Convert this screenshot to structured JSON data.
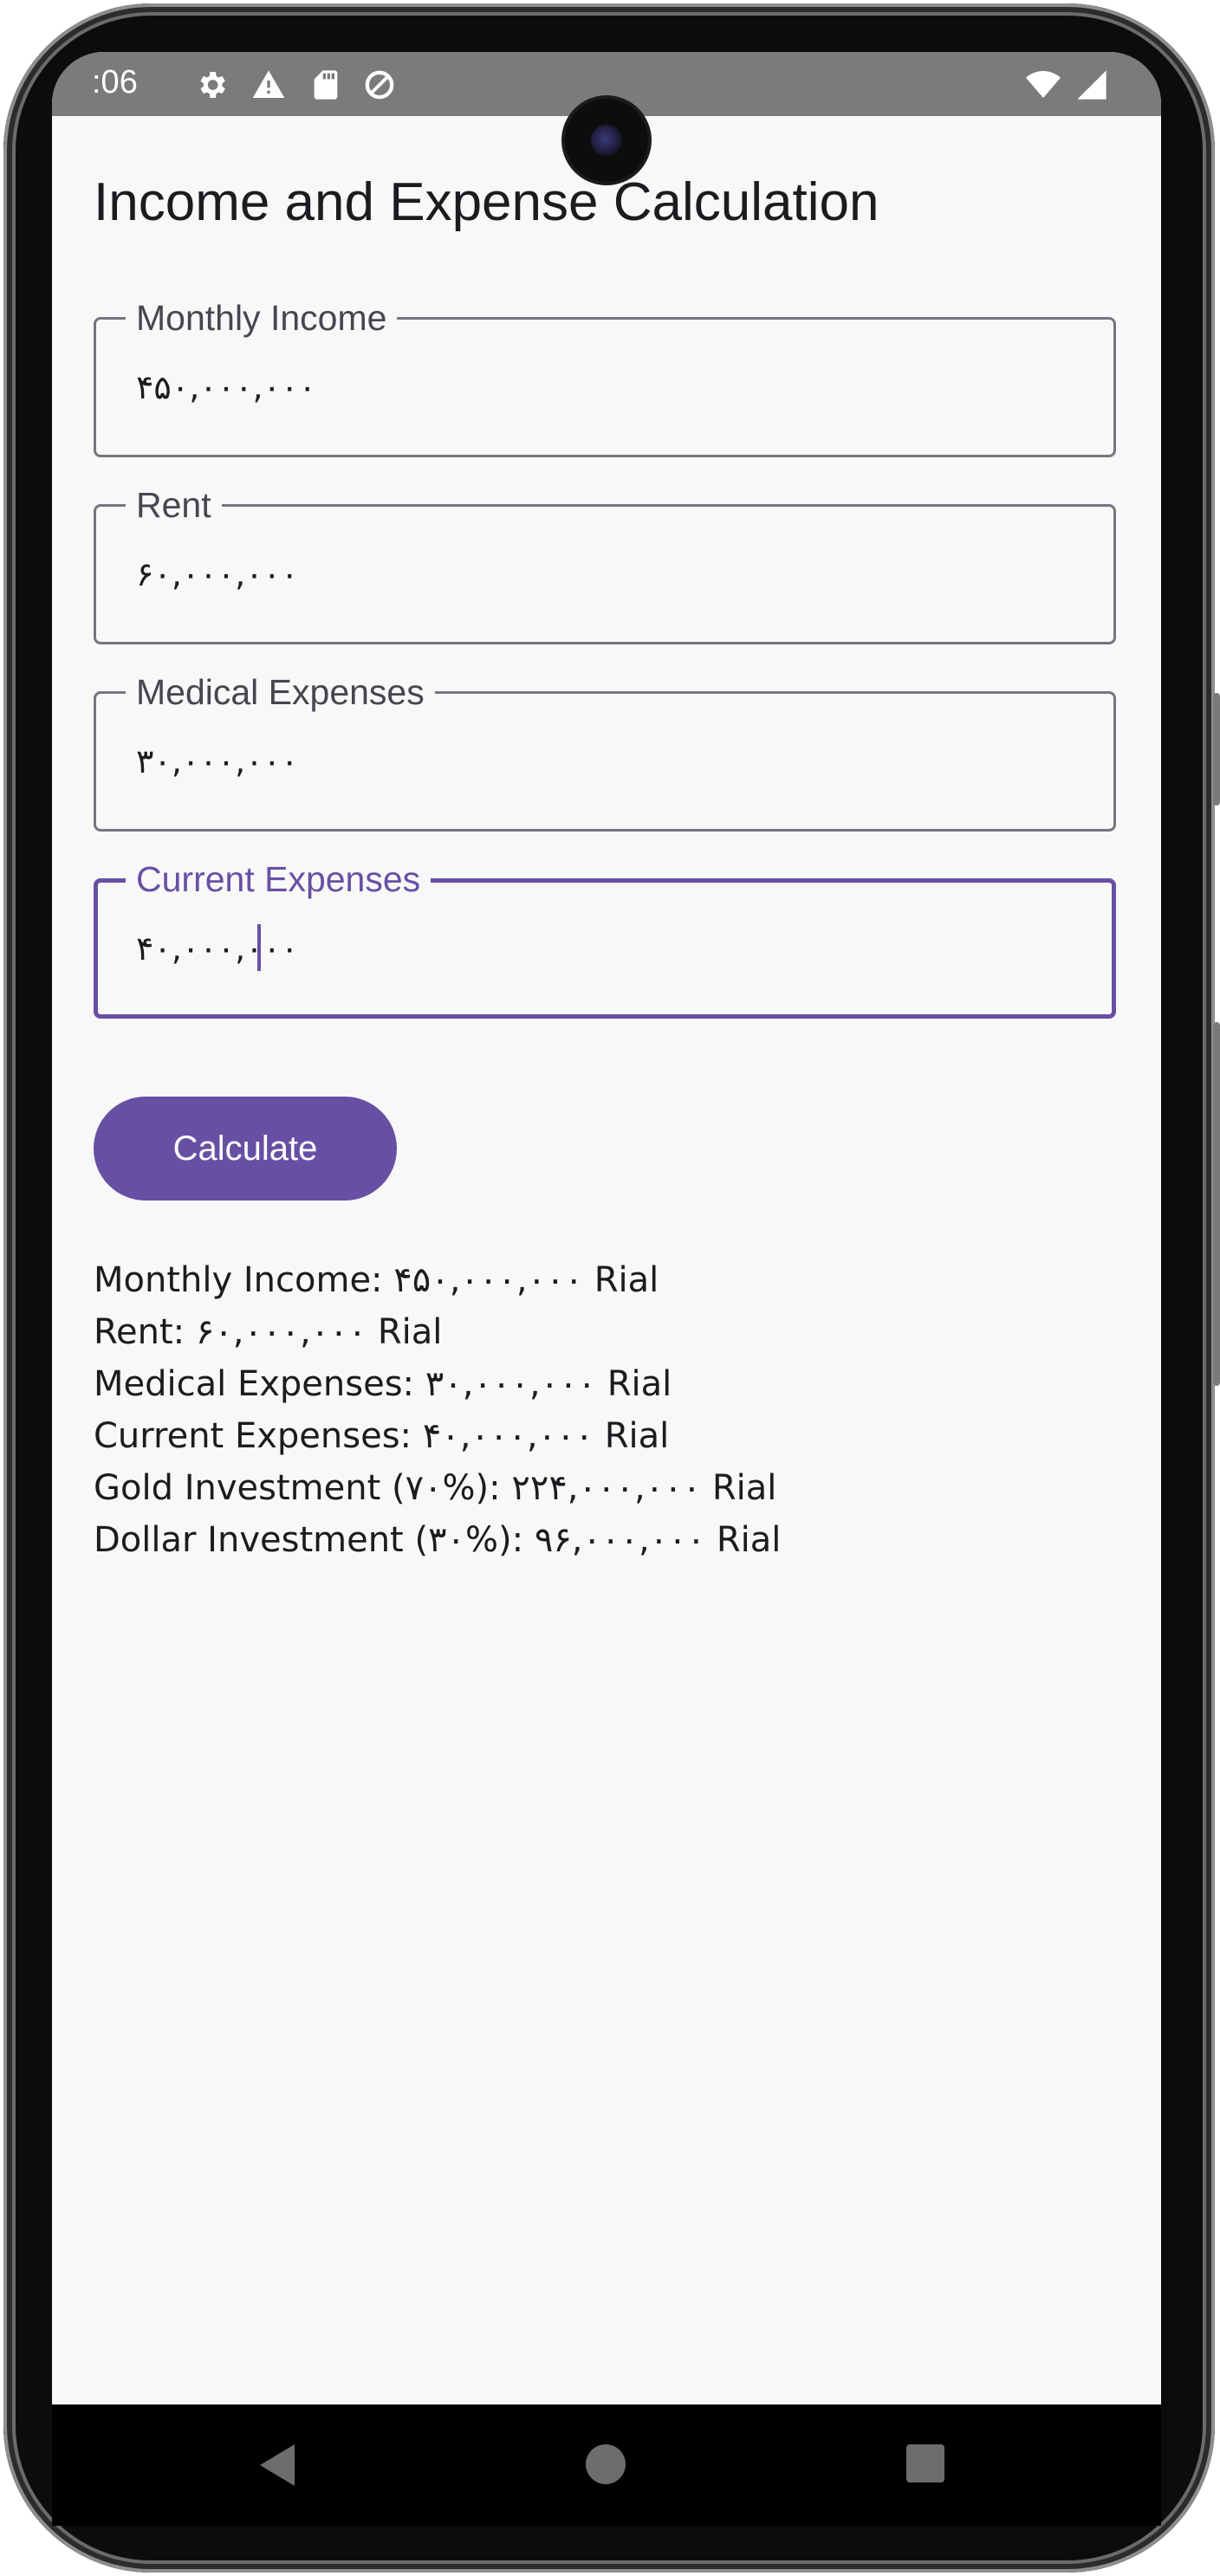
{
  "status_bar": {
    "time": ":06",
    "icons": [
      "settings-icon",
      "warning-icon",
      "sd-card-icon",
      "data-saver-icon",
      "wifi-icon",
      "signal-icon"
    ]
  },
  "app": {
    "title": "Income and Expense Calculation"
  },
  "form": {
    "fields": [
      {
        "label": "Monthly Income",
        "value": "۴۵۰,۰۰۰,۰۰۰"
      },
      {
        "label": "Rent",
        "value": "۶۰,۰۰۰,۰۰۰"
      },
      {
        "label": "Medical Expenses",
        "value": "۳۰,۰۰۰,۰۰۰"
      },
      {
        "label": "Current Expenses",
        "value": "۴۰,۰۰۰,۰۰۰"
      }
    ],
    "calculate_label": "Calculate"
  },
  "results": {
    "lines": [
      "Monthly Income: ۴۵۰,۰۰۰,۰۰۰ Rial",
      "Rent: ۶۰,۰۰۰,۰۰۰ Rial",
      "Medical Expenses: ۳۰,۰۰۰,۰۰۰ Rial",
      "Current Expenses: ۴۰,۰۰۰,۰۰۰ Rial",
      "Gold Investment (۷۰%): ۲۲۴,۰۰۰,۰۰۰ Rial",
      "Dollar Investment (۳۰%): ۹۶,۰۰۰,۰۰۰ Rial"
    ]
  },
  "colors": {
    "primary": "#6750a4",
    "background": "#f8f8f8",
    "status_bar": "#7b7b7b"
  }
}
